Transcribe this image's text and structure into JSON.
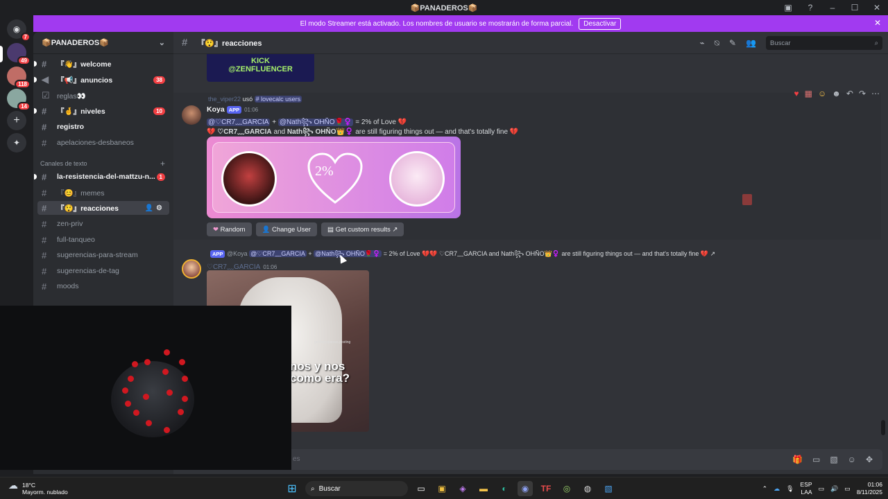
{
  "window": {
    "title": "📦PANADEROS📦",
    "controls": [
      "–",
      "☐",
      "✕"
    ]
  },
  "banner": {
    "text": "El modo Streamer está activado. Los nombres de usuario se mostrarán de forma parcial.",
    "button": "Desactivar",
    "close": "✕",
    "color": "#a13af0"
  },
  "server_rail": {
    "badges": [
      "7",
      "49",
      "118",
      "14"
    ]
  },
  "sidebar": {
    "server_name": "📦PANADEROS📦",
    "channels": [
      {
        "name": "『👋』welcome",
        "badge": ""
      },
      {
        "name": "『📢』anuncios",
        "badge": "38"
      },
      {
        "name": "reglas👀",
        "badge": ""
      },
      {
        "name": "『🤞』niveles",
        "badge": "10"
      },
      {
        "name": "registro",
        "badge": ""
      },
      {
        "name": "apelaciones-desbaneos",
        "badge": ""
      }
    ],
    "category": "Canales de texto",
    "text_channels": [
      {
        "name": "la-resistencia-del-mattzu-n...",
        "badge": "1"
      },
      {
        "name": "『😊』memes",
        "badge": ""
      },
      {
        "name": "『😲』reacciones",
        "badge": ""
      },
      {
        "name": "zen-priv",
        "badge": ""
      },
      {
        "name": "full-tanqueo",
        "badge": ""
      },
      {
        "name": "sugerencias-para-stream",
        "badge": ""
      },
      {
        "name": "sugerencias-de-tag",
        "badge": ""
      },
      {
        "name": "moods",
        "badge": ""
      }
    ]
  },
  "header": {
    "channel": "『😲』reacciones",
    "search_placeholder": "Buscar"
  },
  "messages": {
    "banner_image": {
      "line1": "KICK",
      "line2": "@ZENFLUENCER"
    },
    "reply1": {
      "user": "the_viper22",
      "action": "usó",
      "command": "lovecalc users"
    },
    "msg1": {
      "author": "Koya",
      "tag": "APP",
      "time": "01:06",
      "mention1": "@♡CR7﹏GARCIA",
      "plus": "+",
      "mention2": "@Nath꧂ OHÑO🌹♀️",
      "result": "= 2% of Love 💔",
      "line2_name1": "♡CR7﹏GARCIA",
      "line2_and": "and",
      "line2_name2": "Nath꧂ OHÑO👑♀️",
      "line2_rest": "are still figuring things out — and that's totally fine 💔",
      "card_pct": "2%",
      "buttons": [
        "Random",
        "Change User",
        "Get custom results"
      ]
    },
    "reply2": {
      "tag": "APP",
      "author": "@Koya",
      "mention1": "@♡CR7﹏GARCIA",
      "plus": "+",
      "mention2": "@Nath꧂ OHÑO🌹♀️",
      "text": "= 2% of Love 💔💔 ♡CR7﹏GARCIA and Nath꧂ OHÑO👑♀️ are still figuring things out — and that's totally fine 💔 ↗"
    },
    "msg2": {
      "author": "♡CR7﹏GARCIA",
      "time": "01:06",
      "gif_text": "nos y nos como era?",
      "gif_watermark": "goldusysparsus.posting"
    },
    "composer_hint": "es"
  },
  "taskbar": {
    "weather_temp": "18°C",
    "weather_desc": "Mayorm. nublado",
    "search": "Buscar",
    "lang1": "ESP",
    "lang2": "LAA",
    "time": "01:06",
    "date": "8/11/2025"
  }
}
